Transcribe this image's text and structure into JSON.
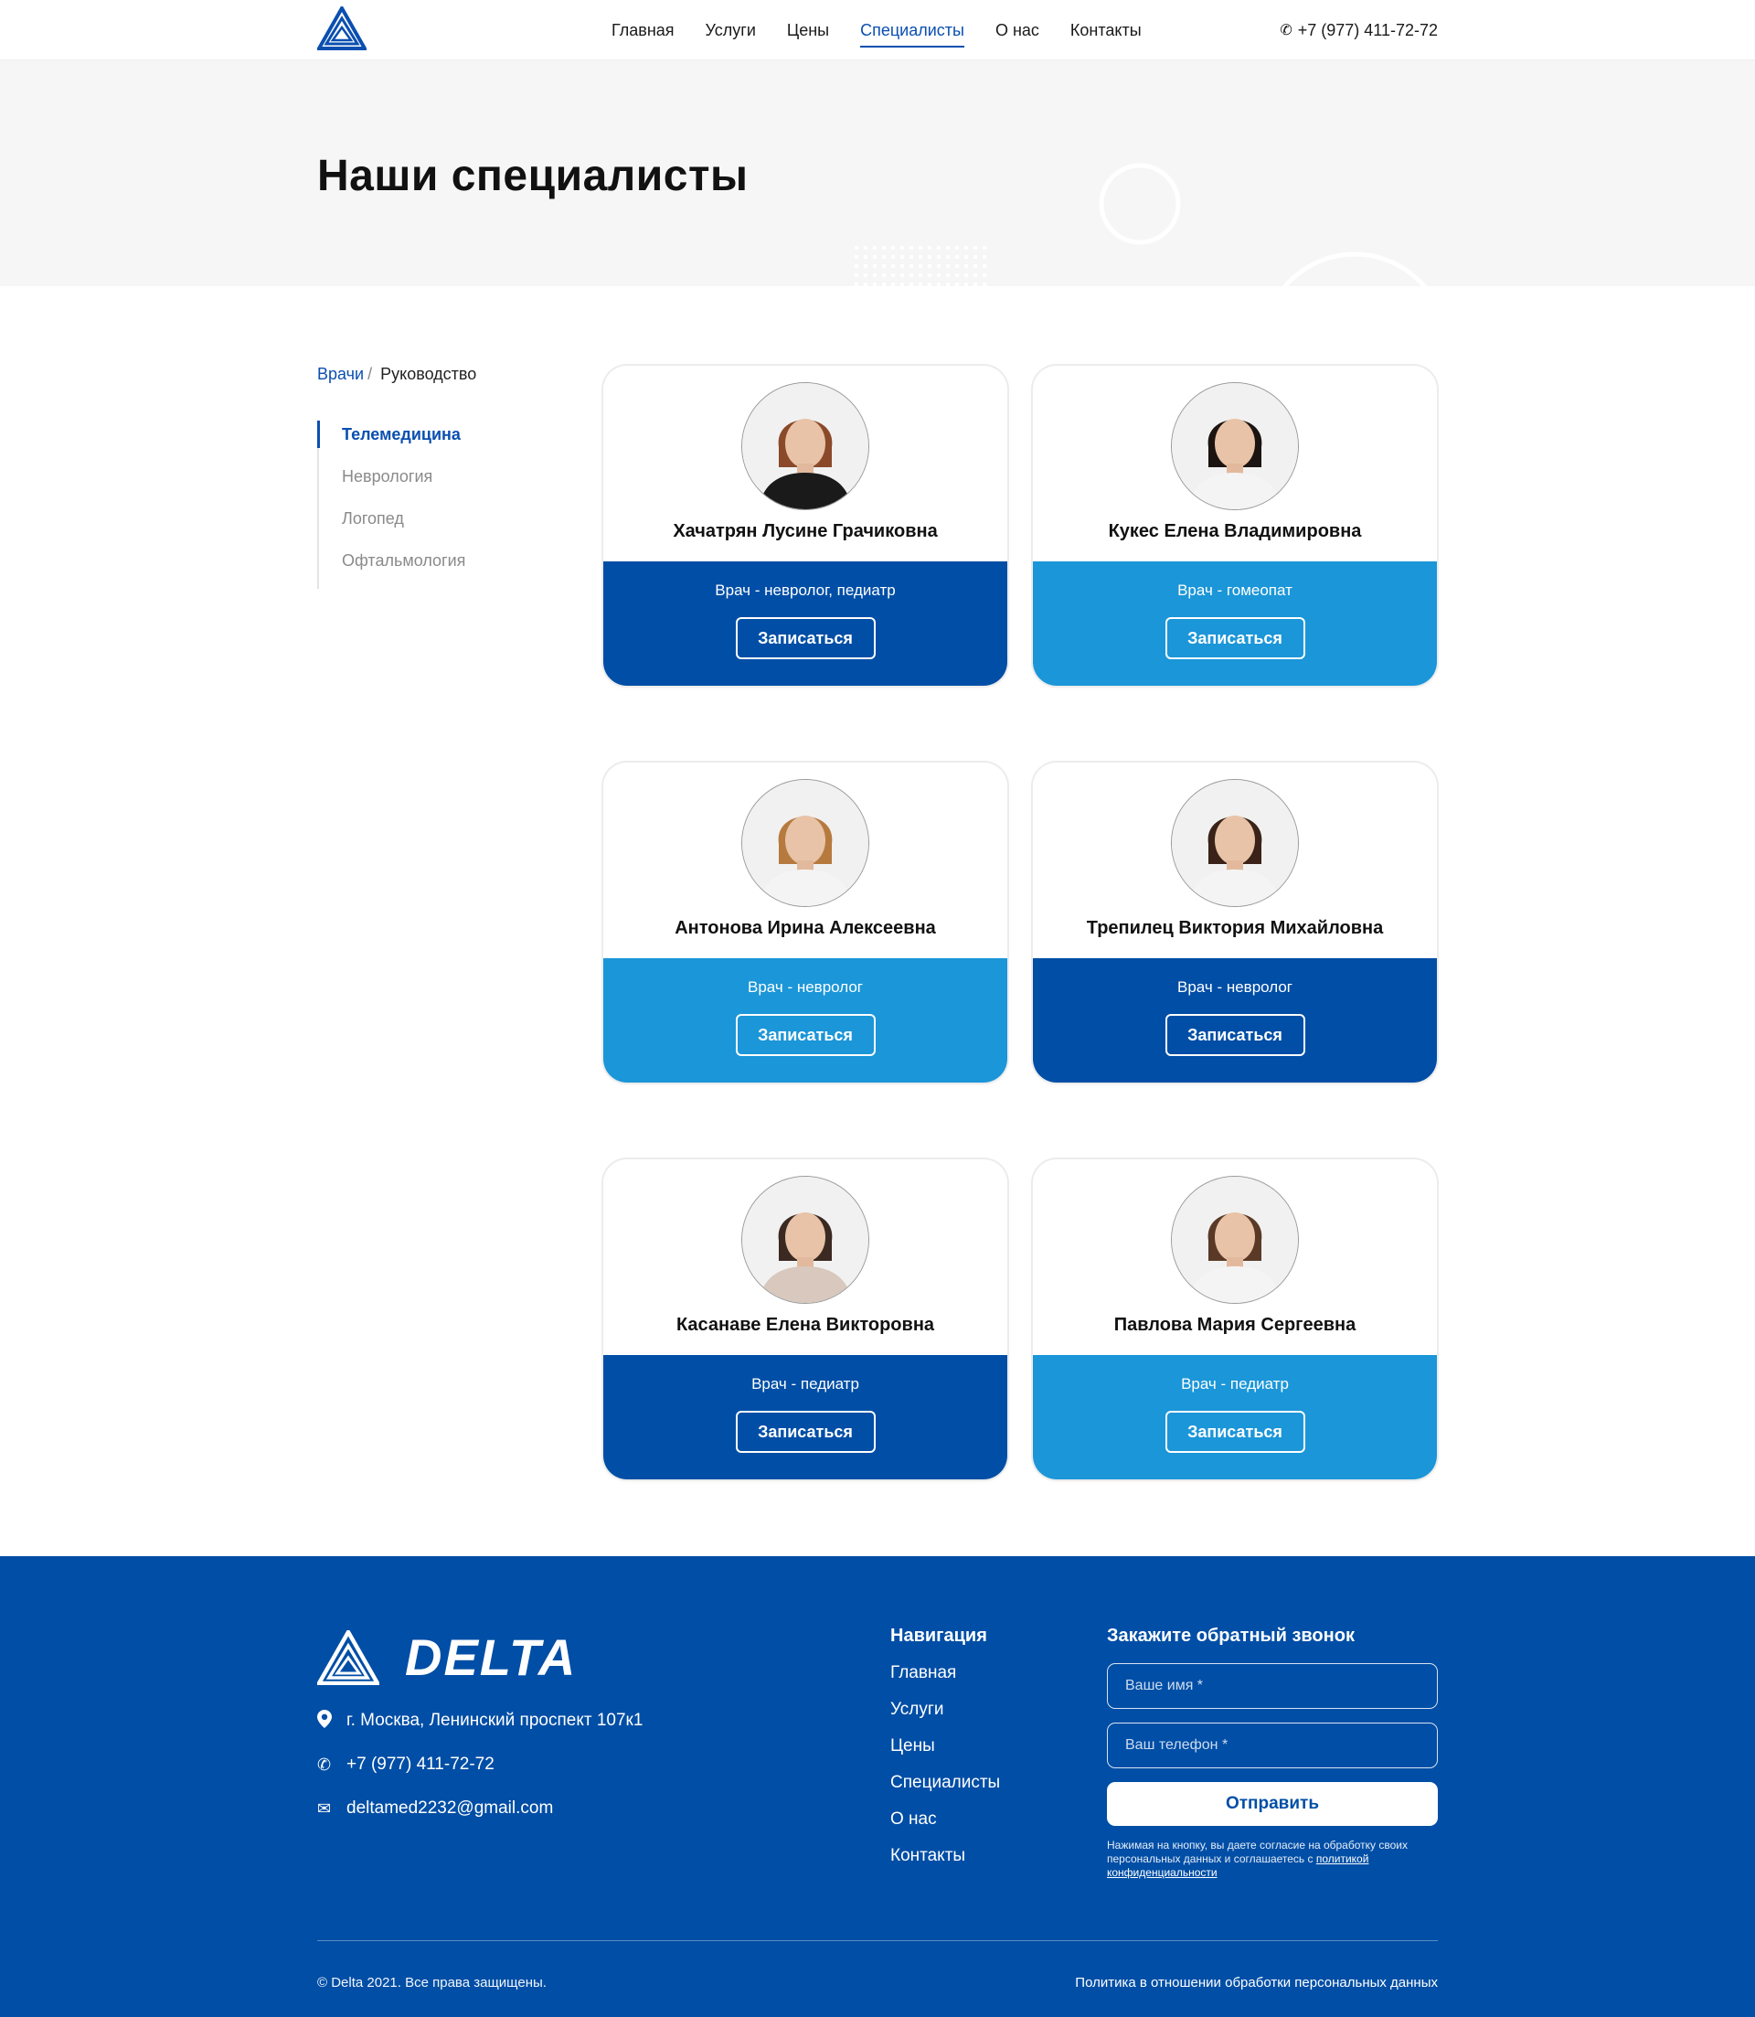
{
  "header": {
    "nav": [
      "Главная",
      "Услуги",
      "Цены",
      "Специалисты",
      "О нас",
      "Контакты"
    ],
    "active_nav": "Специалисты",
    "phone": "+7 (977) 411-72-72"
  },
  "hero": {
    "title": "Наши специалисты"
  },
  "breadcrumb": {
    "link": "Врачи",
    "separator": "/",
    "current": "Руководство"
  },
  "categories": [
    "Телемедицина",
    "Неврология",
    "Логопед",
    "Офтальмология"
  ],
  "doctors": [
    {
      "name": "Хачатрян Лусине Грачиковна",
      "role": "Врач - невролог, педиатр",
      "button": "Записаться",
      "theme": "dark",
      "hair": "#8a4a2a",
      "clothes": "#1a1a1a"
    },
    {
      "name": "Кукес Елена Владимировна",
      "role": "Врач - гомеопат",
      "button": "Записаться",
      "theme": "light",
      "hair": "#1c1410",
      "clothes": "#f4f4f4"
    },
    {
      "name": "Антонова Ирина Алексеевна",
      "role": "Врач - невролог",
      "button": "Записаться",
      "theme": "light",
      "hair": "#b67a3e",
      "clothes": "#f4f4f4"
    },
    {
      "name": "Трепилец Виктория Михайловна",
      "role": "Врач - невролог",
      "button": "Записаться",
      "theme": "dark",
      "hair": "#3a2218",
      "clothes": "#f4f4f4"
    },
    {
      "name": "Касанаве Елена Викторовна",
      "role": "Врач - педиатр",
      "button": "Записаться",
      "theme": "dark",
      "hair": "#3b2a22",
      "clothes": "#d8c8bd"
    },
    {
      "name": "Павлова Мария Сергеевна",
      "role": "Врач - педиатр",
      "button": "Записаться",
      "theme": "light",
      "hair": "#5a3a26",
      "clothes": "#f4f4f4"
    }
  ],
  "colors": {
    "primary": "#004ea6",
    "secondary": "#1b96d8",
    "hero_bg": "#f6f6f6"
  },
  "footer": {
    "brand": "DELTA",
    "address": "г. Москва, Ленинский проспект 107к1",
    "phone": "+7 (977) 411-72-72",
    "email": "deltamed2232@gmail.com",
    "nav_title": "Навигация",
    "nav": [
      "Главная",
      "Услуги",
      "Цены",
      "Специалисты",
      "О нас",
      "Контакты"
    ],
    "form_title": "Закажите обратный звонок",
    "name_placeholder": "Ваше имя *",
    "phone_placeholder": "Ваш телефон *",
    "submit": "Отправить",
    "note_text": "Нажимая на кнопку, вы даете согласие на обработку своих персональных данных и соглашаетесь с ",
    "note_link": "политикой конфиденциальности",
    "copyright": "© Delta 2021. Все права защищены.",
    "policy": "Политика в отношении обработки персональных данных"
  }
}
